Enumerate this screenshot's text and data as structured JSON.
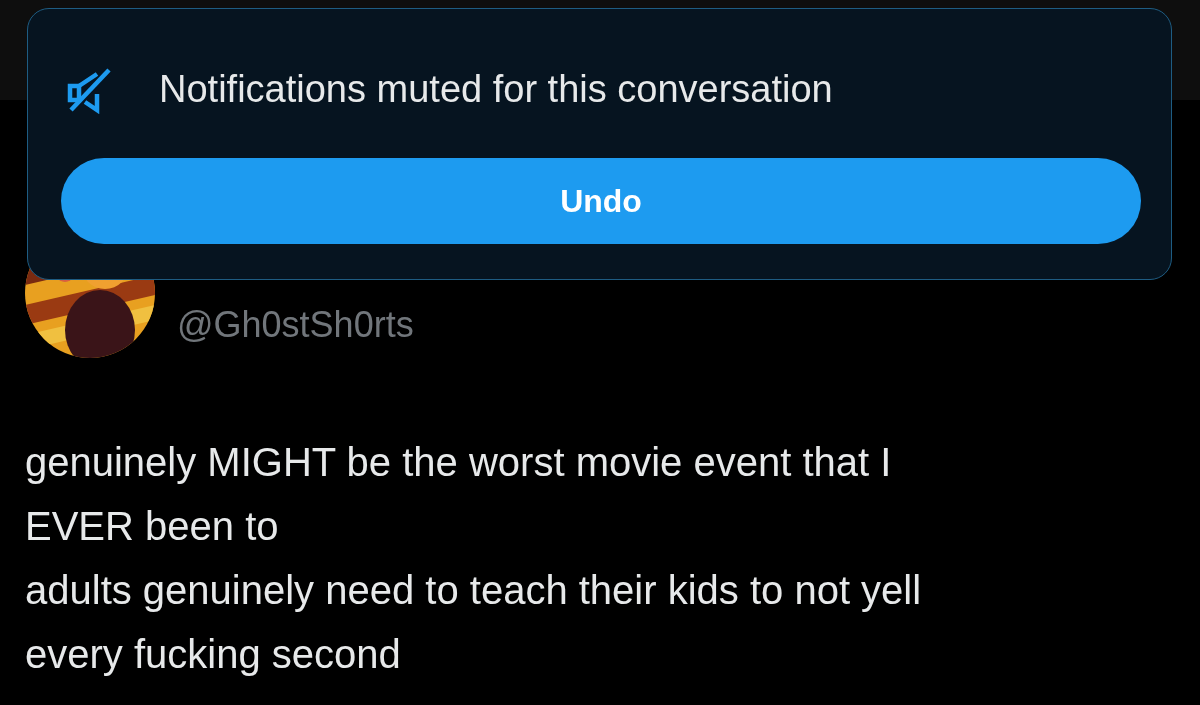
{
  "toast": {
    "message": "Notifications muted for this conversation",
    "button": "Undo"
  },
  "tweet": {
    "handle": "@Gh0stSh0rts",
    "lines": [
      "genuinely MIGHT be the worst movie event that I",
      "EVER been to",
      "adults genuinely need to teach their kids to not yell",
      "every fucking second"
    ]
  }
}
